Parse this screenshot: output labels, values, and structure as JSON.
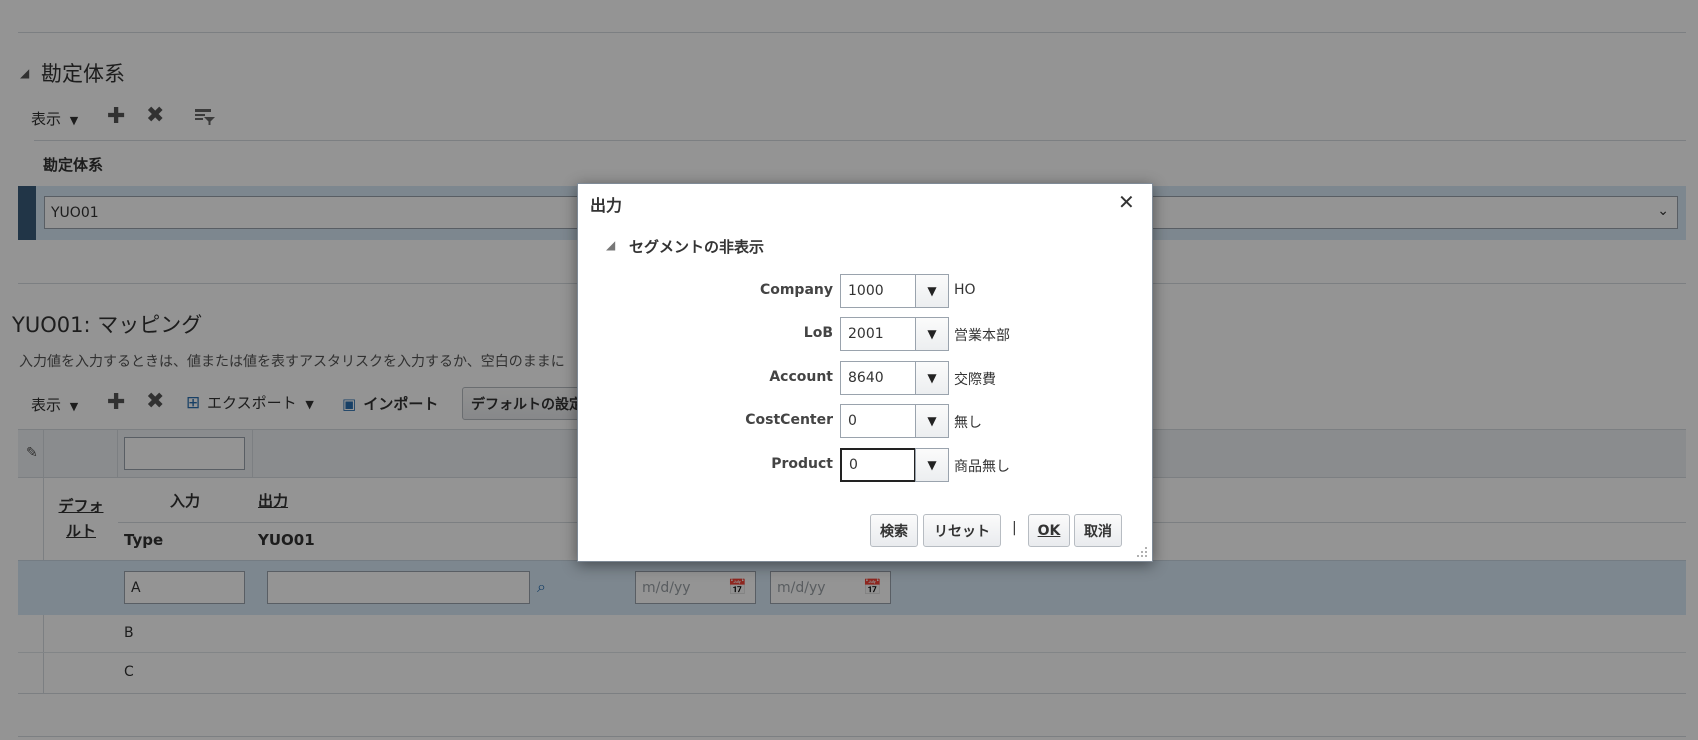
{
  "coa_section": {
    "title": "勘定体系",
    "toolbar": {
      "view_label": "表示"
    },
    "column_header": "勘定体系",
    "selected_value": "YUO01"
  },
  "mapping_section": {
    "title": "YUO01: マッピング",
    "instruction": "入力値を入力するときは、値または値を表すアスタリスクを入力するか、空白のままに",
    "toolbar": {
      "view_label": "表示",
      "export_label": "エクスポート",
      "import_label": "インポート",
      "default_label": "デフォルトの設定"
    },
    "headers": {
      "default": "デフォルト",
      "input": "入力",
      "output": "出力",
      "type": "Type",
      "coa": "YUO01"
    },
    "rows": [
      {
        "type": "A",
        "start_placeholder": "m/d/yy",
        "end_placeholder": "m/d/yy"
      },
      {
        "type": "B"
      },
      {
        "type": "C"
      }
    ]
  },
  "dialog": {
    "title": "出力",
    "section_title": "セグメントの非表示",
    "fields": [
      {
        "label": "Company",
        "value": "1000",
        "desc": "HO"
      },
      {
        "label": "LoB",
        "value": "2001",
        "desc": "営業本部"
      },
      {
        "label": "Account",
        "value": "8640",
        "desc": "交際費"
      },
      {
        "label": "CostCenter",
        "value": "0",
        "desc": "無し"
      },
      {
        "label": "Product",
        "value": "0",
        "desc": "商品無し"
      }
    ],
    "buttons": {
      "search": "検索",
      "reset": "リセット",
      "separator": "|",
      "ok": "OK",
      "cancel": "取消"
    }
  }
}
